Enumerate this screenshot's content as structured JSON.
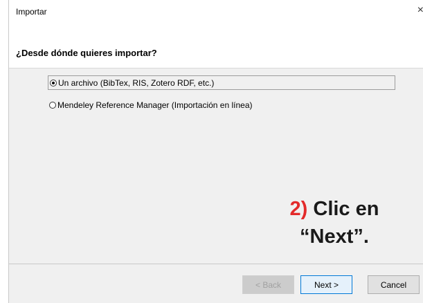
{
  "window": {
    "title": "Importar",
    "close_glyph": "×"
  },
  "header": {
    "question": "¿Desde dónde quieres importar?"
  },
  "options": [
    {
      "label": "Un archivo (BibTex, RIS, Zotero RDF, etc.)",
      "selected": true
    },
    {
      "label": "Mendeley Reference Manager (Importación en línea)",
      "selected": false
    }
  ],
  "annotation": {
    "step": "2)",
    "line1_rest": " Clic en",
    "line2": "“Next”."
  },
  "buttons": {
    "back": "< Back",
    "next": "Next >",
    "cancel": "Cancel"
  }
}
